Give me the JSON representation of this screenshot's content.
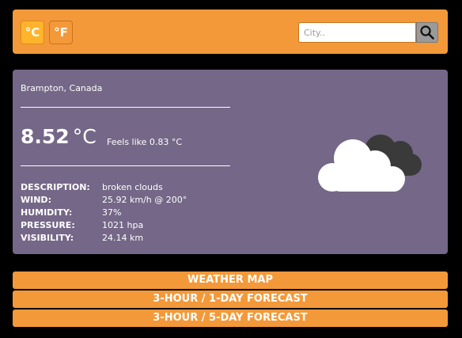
{
  "units": {
    "celsius_label": "°C",
    "fahrenheit_label": "°F",
    "active": "celsius"
  },
  "search": {
    "placeholder": "City.."
  },
  "weather": {
    "location": "Brampton, Canada",
    "temperature": "8.52",
    "temperature_unit": "°C",
    "feels_like": "Feels like 0.83 °C",
    "icon": "broken-clouds-icon",
    "details": [
      {
        "key": "DESCRIPTION:",
        "value": "broken clouds"
      },
      {
        "key": "WIND:",
        "value": "25.92 km/h @ 200°"
      },
      {
        "key": "HUMIDITY:",
        "value": "37%"
      },
      {
        "key": "PRESSURE:",
        "value": "1021 hpa"
      },
      {
        "key": "VISIBILITY:",
        "value": "24.14 km"
      }
    ]
  },
  "nav": {
    "weather_map": "WEATHER MAP",
    "forecast_1day": "3-HOUR / 1-DAY FORECAST",
    "forecast_5day": "3-HOUR / 5-DAY FORECAST"
  },
  "colors": {
    "accent": "#f3993a",
    "active_unit": "#ffb42b",
    "card": "#746787",
    "background": "#000000"
  }
}
